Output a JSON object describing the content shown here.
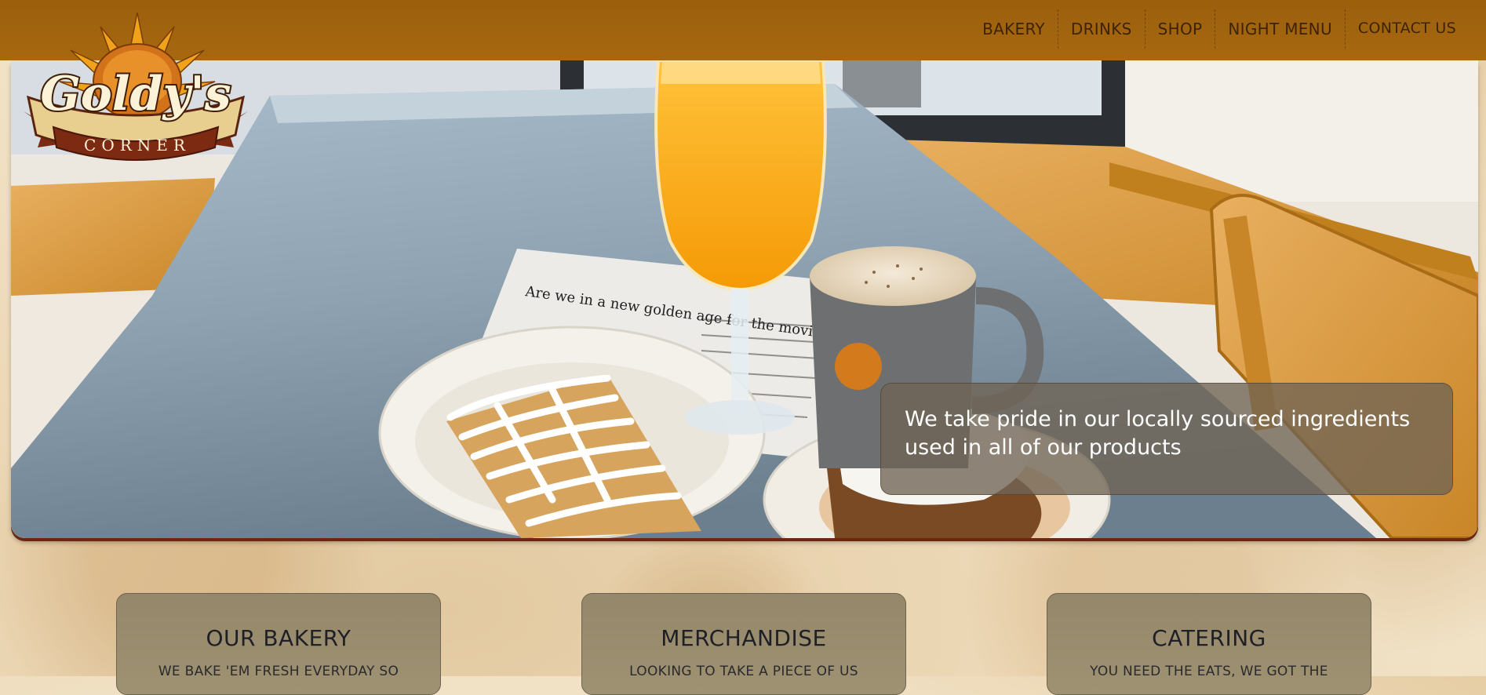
{
  "brand": {
    "logo_text_main": "Goldy's",
    "logo_text_sub": "CORNER"
  },
  "nav": {
    "items": [
      {
        "label": "BAKERY"
      },
      {
        "label": "DRINKS"
      },
      {
        "label": "SHOP"
      },
      {
        "label": "NIGHT MENU"
      },
      {
        "label": "CONTACT US"
      }
    ]
  },
  "hero": {
    "tagline": "We take pride in our locally sourced ingredients used in all of our products",
    "newspaper_headline": "Are we in a new golden age for the movie soundtrack?"
  },
  "cards": [
    {
      "title": "OUR BAKERY",
      "subtitle": "WE BAKE 'EM FRESH EVERYDAY SO"
    },
    {
      "title": "MERCHANDISE",
      "subtitle": "LOOKING TO TAKE A PIECE OF US"
    },
    {
      "title": "CATERING",
      "subtitle": "YOU NEED THE EATS, WE GOT THE"
    }
  ],
  "colors": {
    "header": "#a7680f",
    "nav_text": "#3d2306",
    "card_bg": "#9b8d6e",
    "hero_border": "#6b2710"
  },
  "icons": {
    "logo_sun": "sun-icon"
  }
}
